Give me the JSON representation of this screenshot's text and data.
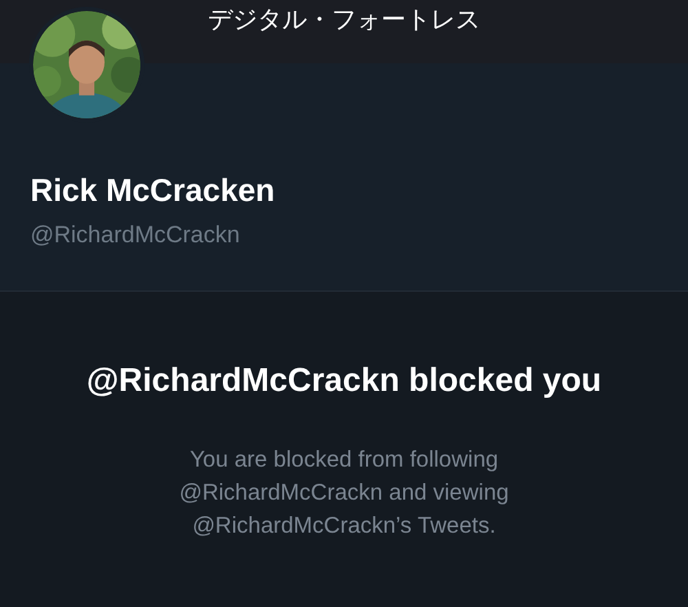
{
  "window": {
    "title": "デジタル・フォートレス"
  },
  "profile": {
    "name": "Rick McCracken",
    "handle": "@RichardMcCrackn"
  },
  "blocked_notice": {
    "heading": "@RichardMcCrackn blocked you",
    "message": "You are blocked from following @RichardMcCrackn and viewing @RichardMcCrackn’s Tweets."
  }
}
